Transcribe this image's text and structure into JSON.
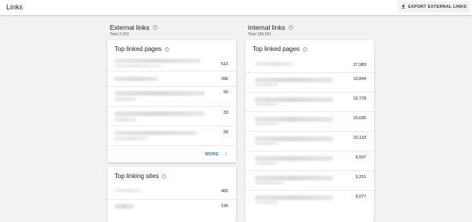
{
  "app_title": "Links",
  "export_button": {
    "label": "EXPORT EXTERNAL LINKS",
    "icon": "download-icon"
  },
  "external": {
    "title": "External links",
    "total": "Total 2,423",
    "top_linked_pages": {
      "title": "Top linked pages",
      "values": [
        "510",
        "396",
        "95",
        "33",
        "28"
      ],
      "more_label": "MORE"
    },
    "top_linking_sites": {
      "title": "Top linking sites",
      "values": [
        "481",
        "130"
      ]
    }
  },
  "internal": {
    "title": "Internal links",
    "total": "Total 189,561",
    "top_linked_pages": {
      "title": "Top linked pages",
      "values": [
        "27,983",
        "10,844",
        "10,778",
        "10,635",
        "10,133",
        "9,507",
        "9,315",
        "8,077"
      ]
    }
  },
  "colors": {
    "accent": "#1a73e8",
    "background": "#f2f2f2",
    "card": "#ffffff",
    "divider": "#e8eaed"
  }
}
